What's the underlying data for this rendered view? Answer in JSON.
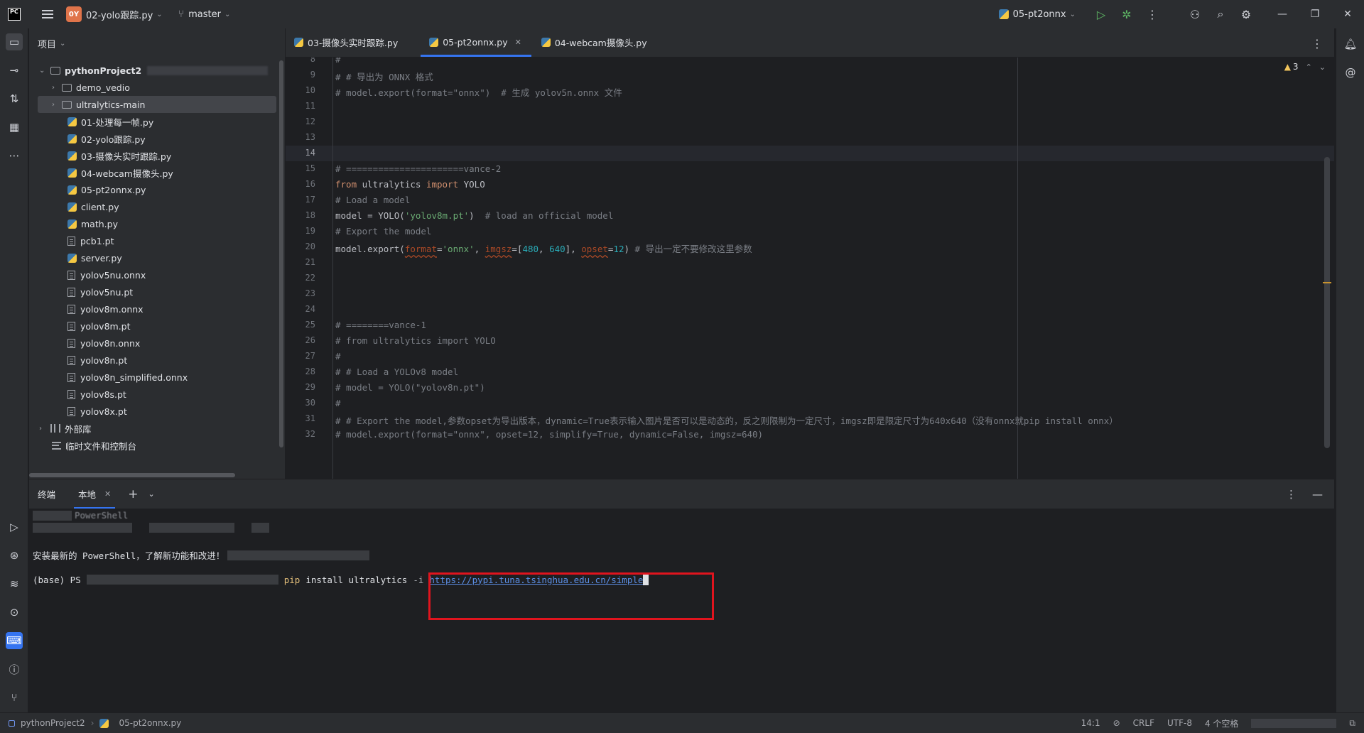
{
  "titlebar": {
    "badge": "0Y",
    "project_file": "02-yolo跟踪.py",
    "branch": "master",
    "run_config": "05-pt2onnx"
  },
  "project_panel": {
    "title": "项目",
    "root": "pythonProject2",
    "items": [
      {
        "label": "demo_vedio",
        "type": "folder"
      },
      {
        "label": "ultralytics-main",
        "type": "folder"
      },
      {
        "label": "01-处理每一帧.py",
        "type": "py"
      },
      {
        "label": "02-yolo跟踪.py",
        "type": "py"
      },
      {
        "label": "03-摄像头实时跟踪.py",
        "type": "py"
      },
      {
        "label": "04-webcam摄像头.py",
        "type": "py"
      },
      {
        "label": "05-pt2onnx.py",
        "type": "py"
      },
      {
        "label": "client.py",
        "type": "py"
      },
      {
        "label": "math.py",
        "type": "py"
      },
      {
        "label": "pcb1.pt",
        "type": "file"
      },
      {
        "label": "server.py",
        "type": "py"
      },
      {
        "label": "yolov5nu.onnx",
        "type": "file"
      },
      {
        "label": "yolov5nu.pt",
        "type": "file"
      },
      {
        "label": "yolov8m.onnx",
        "type": "file"
      },
      {
        "label": "yolov8m.pt",
        "type": "file"
      },
      {
        "label": "yolov8n.onnx",
        "type": "file"
      },
      {
        "label": "yolov8n.pt",
        "type": "file"
      },
      {
        "label": "yolov8n_simplified.onnx",
        "type": "file"
      },
      {
        "label": "yolov8s.pt",
        "type": "file"
      },
      {
        "label": "yolov8x.pt",
        "type": "file"
      }
    ],
    "external_libs": "外部库",
    "scratches": "临时文件和控制台"
  },
  "editor_tabs": [
    {
      "label": "03-摄像头实时跟踪.py"
    },
    {
      "label": "05-pt2onnx.py",
      "active": true
    },
    {
      "label": "04-webcam摄像头.py"
    }
  ],
  "editor": {
    "warning_count": "3",
    "lines": [
      {
        "n": "8",
        "text": "#"
      },
      {
        "n": "9",
        "text": "# # 导出为 ONNX 格式"
      },
      {
        "n": "10",
        "text": "# model.export(format=\"onnx\")  # 生成 yolov5n.onnx 文件"
      },
      {
        "n": "11",
        "text": ""
      },
      {
        "n": "12",
        "text": ""
      },
      {
        "n": "13",
        "text": ""
      },
      {
        "n": "14",
        "text": ""
      },
      {
        "n": "15",
        "text": "# ======================vance-2"
      },
      {
        "n": "16",
        "text": "from ultralytics import YOLO"
      },
      {
        "n": "17",
        "text": "# Load a model"
      },
      {
        "n": "18",
        "text": "model = YOLO('yolov8m.pt')  # load an official model"
      },
      {
        "n": "19",
        "text": "# Export the model"
      },
      {
        "n": "20",
        "text": "model.export(format='onnx', imgsz=[480, 640], opset=12) # 导出一定不要修改这里参数"
      },
      {
        "n": "21",
        "text": ""
      },
      {
        "n": "22",
        "text": ""
      },
      {
        "n": "23",
        "text": ""
      },
      {
        "n": "24",
        "text": ""
      },
      {
        "n": "25",
        "text": "# ========vance-1"
      },
      {
        "n": "26",
        "text": "# from ultralytics import YOLO"
      },
      {
        "n": "27",
        "text": "#"
      },
      {
        "n": "28",
        "text": "# # Load a YOLOv8 model"
      },
      {
        "n": "29",
        "text": "# model = YOLO(\"yolov8n.pt\")"
      },
      {
        "n": "30",
        "text": "#"
      },
      {
        "n": "31",
        "text": "# # Export the model,参数opset为导出版本，dynamic=True表示输入图片是否可以是动态的，反之则限制为一定尺寸，imgsz即是限定尺寸为640x640（没有onnx就pip install onnx）"
      },
      {
        "n": "32",
        "text": "# model.export(format=\"onnx\", opset=12, simplify=True, dynamic=False, imgsz=640)"
      }
    ]
  },
  "terminal": {
    "title": "终端",
    "tab": "本地",
    "line1": "PowerShell",
    "line3": "安装最新的 PowerShell，了解新功能和改进！",
    "prompt": "(base) PS",
    "cmd_pip": "pip",
    "cmd_rest": "install ultralytics",
    "cmd_opt": "-i",
    "cmd_url": "https://pypi.tuna.tsinghua.edu.cn/simple"
  },
  "statusbar": {
    "project": "pythonProject2",
    "file": "05-pt2onnx.py",
    "position": "14:1",
    "line_ending": "CRLF",
    "encoding": "UTF-8",
    "indent": "4 个空格"
  },
  "colors": {
    "accent": "#3574f0",
    "highlight_box": "#e0141e"
  }
}
